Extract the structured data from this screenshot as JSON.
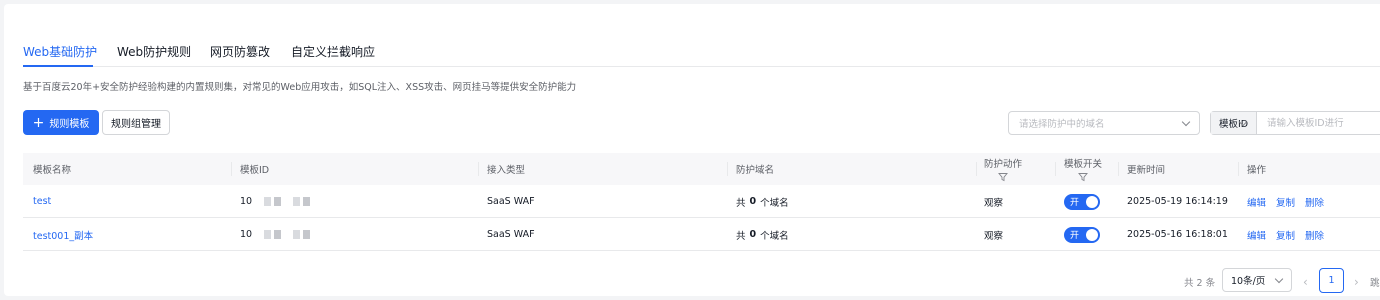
{
  "tabs": [
    {
      "label": "Web基础防护",
      "active": true
    },
    {
      "label": "Web防护规则",
      "active": false
    },
    {
      "label": "网页防篡改",
      "active": false
    },
    {
      "label": "自定义拦截响应",
      "active": false
    }
  ],
  "description": "基于百度云20年+安全防护经验构建的内置规则集，对常见的Web应用攻击，如SQL注入、XSS攻击、网页挂马等提供安全防护能力",
  "toolbar": {
    "rule_template_button": "规则模板",
    "rule_group_button": "规则组管理",
    "domain_select_placeholder": "请选择防护中的域名",
    "template_field_select": "模板ID",
    "template_search_placeholder": "请输入模板ID进行"
  },
  "table": {
    "headers": [
      "模板名称",
      "模板ID",
      "接入类型",
      "防护域名",
      "防护动作",
      "模板开关",
      "更新时间",
      "操作"
    ],
    "rows": [
      {
        "name": "test",
        "id_prefix": "10",
        "access_type": "SaaS WAF",
        "domains_pre": "共",
        "domains_count": "0",
        "domains_post": "个域名",
        "action": "观察",
        "switch_label": "开",
        "updated": "2025-05-19 16:14:19",
        "ops": [
          "编辑",
          "复制",
          "删除"
        ]
      },
      {
        "name": "test001_副本",
        "id_prefix": "10",
        "access_type": "SaaS WAF",
        "domains_pre": "共",
        "domains_count": "0",
        "domains_post": "个域名",
        "action": "观察",
        "switch_label": "开",
        "updated": "2025-05-16 16:18:01",
        "ops": [
          "编辑",
          "复制",
          "删除"
        ]
      }
    ]
  },
  "pagination": {
    "total": "共 2 条",
    "page_size": "10条/页",
    "current_page": "1",
    "jump_label": "跳"
  },
  "colors": {
    "accent": "#2468f2"
  }
}
